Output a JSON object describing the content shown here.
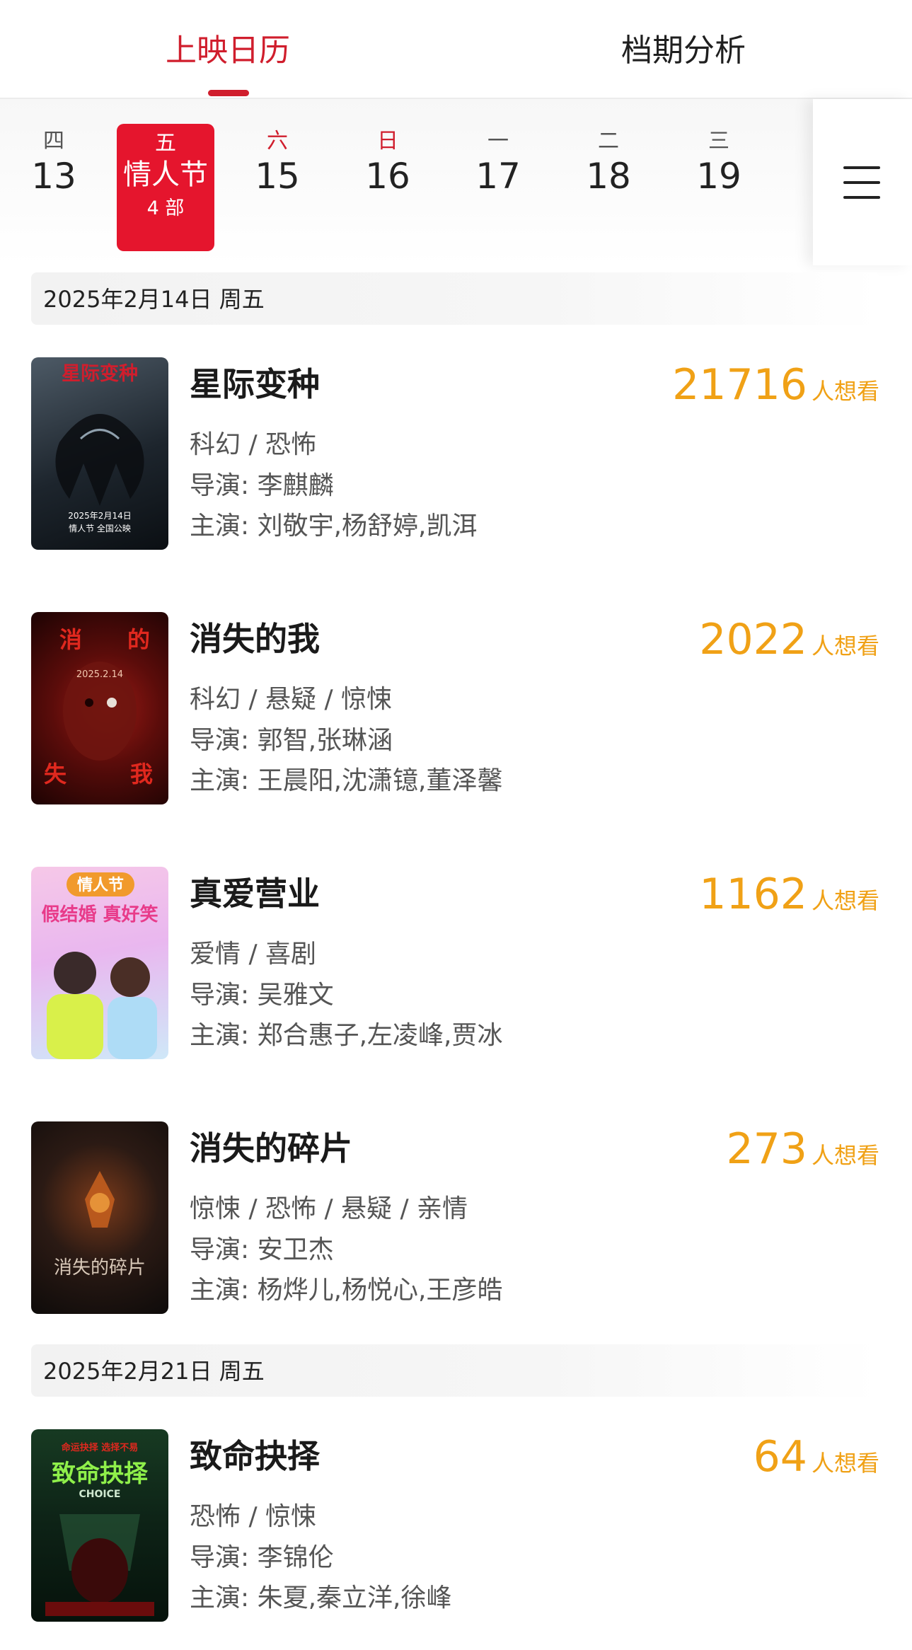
{
  "tabs": [
    {
      "label": "上映日历",
      "active": true
    },
    {
      "label": "档期分析",
      "active": false
    }
  ],
  "days": [
    {
      "weekday": "四",
      "date": "13"
    },
    {
      "weekday": "五",
      "date": "情人节",
      "count": "4 部",
      "selected": true
    },
    {
      "weekday": "六",
      "date": "15"
    },
    {
      "weekday": "日",
      "date": "16"
    },
    {
      "weekday": "一",
      "date": "17"
    },
    {
      "weekday": "二",
      "date": "18"
    },
    {
      "weekday": "三",
      "date": "19"
    }
  ],
  "menu_icon": "menu-icon",
  "groups": [
    {
      "date": "2025年2月14日  周五",
      "movies": [
        {
          "title": "星际变种",
          "want_count": "21716",
          "want_label": "人想看",
          "genre": "科幻 / 恐怖",
          "director": "导演:  李麒麟",
          "cast": "主演:  刘敬宇,杨舒婷,凯洱",
          "poster_text": "星际变种",
          "poster_sub": "2025年2月14日\n情人节 全国公映"
        },
        {
          "title": "消失的我",
          "want_count": "2022",
          "want_label": "人想看",
          "genre": "科幻 / 悬疑 / 惊悚",
          "director": "导演:  郭智,张琳涵",
          "cast": "主演:  王晨阳,沈潇镱,董泽馨",
          "poster_text": "消失的我",
          "poster_sub": "2025.2.14"
        },
        {
          "title": "真爱营业",
          "want_count": "1162",
          "want_label": "人想看",
          "genre": "爱情 / 喜剧",
          "director": "导演:  吴雅文",
          "cast": "主演:  郑合惠子,左凌峰,贾冰",
          "poster_text": "情人节",
          "poster_sub": "假结婚 真好笑"
        },
        {
          "title": "消失的碎片",
          "want_count": "273",
          "want_label": "人想看",
          "genre": "惊悚 / 恐怖 / 悬疑 / 亲情",
          "director": "导演:  安卫杰",
          "cast": "主演:  杨烨儿,杨悦心,王彦皓",
          "poster_text": "消失的碎片",
          "poster_sub": ""
        }
      ]
    },
    {
      "date": "2025年2月21日  周五",
      "movies": [
        {
          "title": "致命抉择",
          "want_count": "64",
          "want_label": "人想看",
          "genre": "恐怖 / 惊悚",
          "director": "导演:  李锦伦",
          "cast": "主演:  朱夏,秦立洋,徐峰",
          "poster_text": "致命抉择",
          "poster_sub": "CHOICE"
        }
      ]
    }
  ],
  "colors": {
    "accent": "#d01e2d",
    "selected_day": "#e5152d",
    "want": "#f0a116"
  }
}
